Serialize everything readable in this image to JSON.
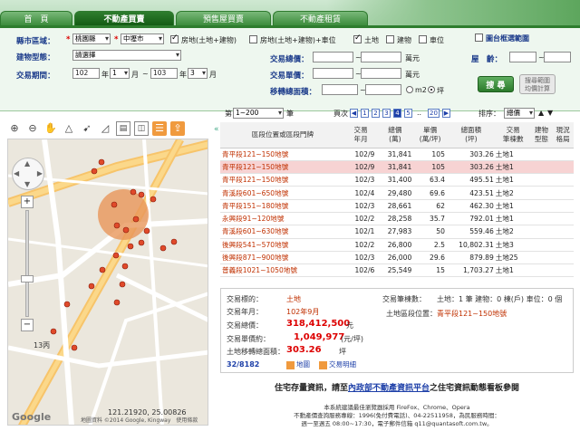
{
  "tabs": [
    "首　頁",
    "不動產買賣",
    "預售屋買賣",
    "不動產租賃"
  ],
  "form": {
    "city_label": "縣市區域：",
    "city_value": "桃園縣",
    "district_value": "中壢市",
    "type_opts": [
      "房地(土地+建物)",
      "房地(土地+建物)+車位",
      "土地",
      "建物",
      "車位"
    ],
    "map_select_label": "圖台框選範圍",
    "building_label": "建物型態：",
    "building_value": "請選擇",
    "period_label": "交易期間：",
    "year_from": "102",
    "month_from": "1",
    "year_to": "103",
    "month_to": "3",
    "year_unit": "年",
    "month_unit": "月",
    "tilde": "~",
    "total_label": "交易總價：",
    "total_unit": "萬元",
    "unit_label": "交易單價：",
    "area_label": "移轉總面積：",
    "m2": "m2",
    "ping": "坪",
    "age_label": "屋　齡：",
    "search_btn": "搜 尋",
    "search_btn2": "搜尋範圍\n均價計算"
  },
  "pager": {
    "range_prefix": "第",
    "range_value": "1~200",
    "range_suffix": "筆",
    "page_label": "頁次",
    "pages": [
      "1",
      "2",
      "3",
      "4",
      "5"
    ],
    "current_page": "4",
    "dots": "..",
    "last": "20",
    "sort_label": "排序：",
    "sort_value": "總價"
  },
  "table": {
    "headers": [
      "區段位置或區段門牌",
      "交易\n年月",
      "總價\n(萬)",
      "單價\n(萬/坪)",
      "總面積\n(坪)",
      "交易\n筆棟數",
      "建物\n型態",
      "現況\n格局"
    ],
    "rows": [
      [
        "青平段121~150地號",
        "102/9",
        "31,841",
        "105",
        "303.26",
        "土地1"
      ],
      [
        "青平段121~150地號",
        "102/9",
        "31,841",
        "105",
        "303.26",
        "土地1"
      ],
      [
        "青平段121~150地號",
        "102/3",
        "31,400",
        "63.4",
        "495.51",
        "土地1"
      ],
      [
        "青溪段601~650地號",
        "102/4",
        "29,480",
        "69.6",
        "423.51",
        "土地2"
      ],
      [
        "青平段151~180地號",
        "102/3",
        "28,661",
        "62",
        "462.30",
        "土地1"
      ],
      [
        "永興段91~120地號",
        "102/2",
        "28,258",
        "35.7",
        "792.01",
        "土地1"
      ],
      [
        "青溪段601~630地號",
        "102/1",
        "27,983",
        "50",
        "559.46",
        "土地2"
      ],
      [
        "後興段541~570地號",
        "102/2",
        "26,800",
        "2.5",
        "10,802.31",
        "土地3"
      ],
      [
        "後興段871~900地號",
        "102/3",
        "26,000",
        "29.6",
        "879.89",
        "土地25"
      ],
      [
        "普義段1021~1050地號",
        "102/6",
        "25,549",
        "15",
        "1,703.27",
        "土地1"
      ]
    ]
  },
  "detail": {
    "type_label": "交易標的：",
    "type_value": "土地",
    "date_label": "交易年月：",
    "date_value": "102年9月",
    "total_label": "交易總價：",
    "total_value": "318,412,500",
    "total_unit": "元",
    "price_label": "交易單價約：",
    "price_value": "1,049,977",
    "price_unit": "(元/坪)",
    "area_label": "土地移轉總面積：",
    "area_value": "303.26",
    "area_unit": "坪",
    "count_label": "交易筆棟數：",
    "count_value": "土地：1 筆 建物：0 棟(戶) 車位：0 個",
    "pos_label": "土地區段位置：",
    "pos_value": "青平段121~150地號",
    "index": "32/8182",
    "map_btn": "地圖",
    "note_btn": "交易明細"
  },
  "map": {
    "coord": "121.21920, 25.00826",
    "copyright": "地圖資料 ©2014 Google, Kingway　使用條款",
    "google": "Google",
    "road_label": "13丙"
  },
  "promo": {
    "prefix": "住宅存量資訊，請至",
    "link": "內政部不動產資訊平台",
    "suffix": "之住宅資訊動態看板參閱"
  },
  "footer": {
    "line1": "本系統建議最佳瀏覽器採用 FireFox、Chrome、Opera",
    "line2": "不動產價查詢服務專線：1996(免付費電話)、04-22511958，為民服務時間：",
    "line3": "週一至週五 08:00~17:30，電子郵件信箱 q11@quantasoft.com.tw。"
  }
}
